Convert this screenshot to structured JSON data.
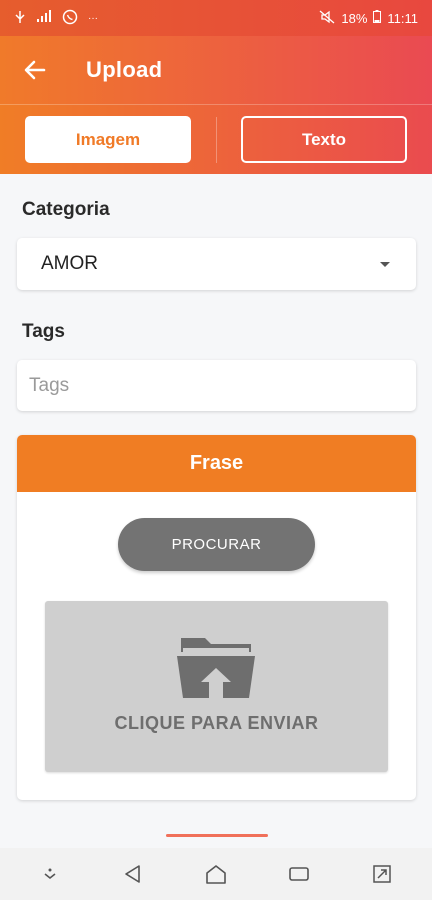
{
  "status_bar": {
    "battery": "18%",
    "time": "11:11",
    "icons": [
      "usb-icon",
      "signal-icon",
      "whatsapp-icon",
      "more-icon",
      "mute-icon"
    ]
  },
  "app_bar": {
    "back_icon": "arrow-left-icon",
    "title": "Upload"
  },
  "tabs": [
    {
      "label": "Imagem",
      "active": true
    },
    {
      "label": "Texto",
      "active": false
    }
  ],
  "categoria": {
    "label": "Categoria",
    "selected": "AMOR"
  },
  "tags": {
    "label": "Tags",
    "value": "",
    "placeholder": "Tags"
  },
  "frase": {
    "header": "Frase",
    "procurar_label": "PROCURAR",
    "dropzone_icon": "folder-upload-icon",
    "dropzone_text": "CLIQUE PARA ENVIAR"
  },
  "navbar": {
    "icons": [
      "hide-nav-icon",
      "back-triangle-icon",
      "home-icon",
      "recents-icon",
      "expand-icon"
    ]
  },
  "colors": {
    "accent_orange": "#f07d23",
    "accent_red": "#ea4a52",
    "button_gray": "#737373",
    "dropzone_gray": "#cfcfcf"
  }
}
